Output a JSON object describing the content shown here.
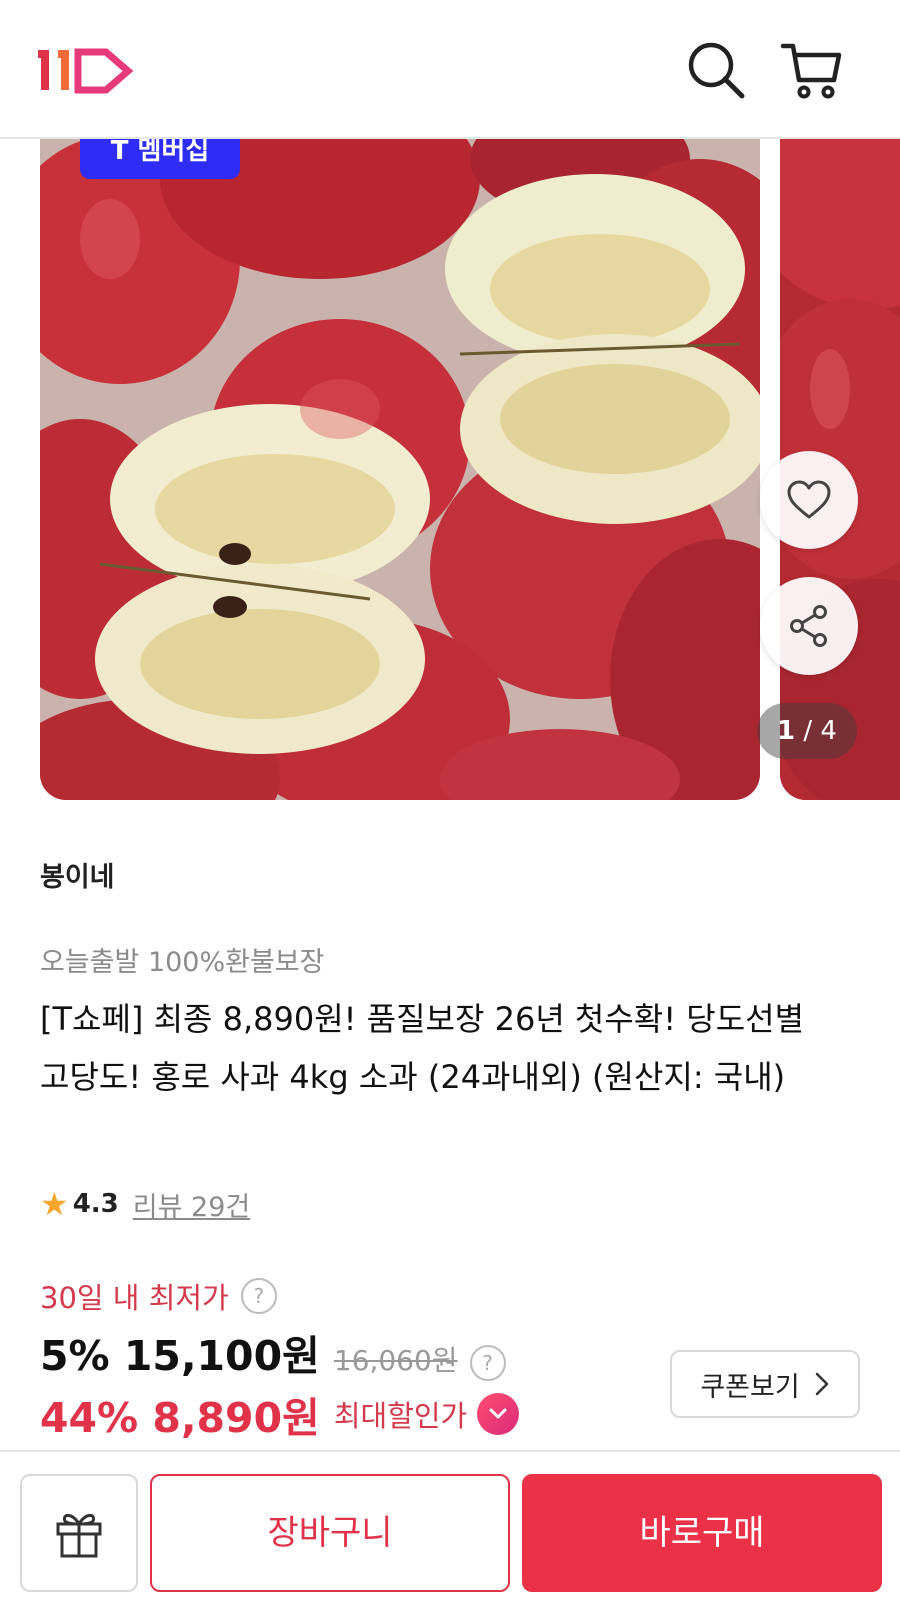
{
  "header": {
    "logo_alt": "11번가",
    "search_icon": "search-icon",
    "cart_icon": "cart-icon",
    "brand_color": "#e0334a"
  },
  "gallery": {
    "badge": "T 멤버십",
    "page_current": "1",
    "page_total": "4",
    "page_separator": " / ",
    "like_icon": "heart-outline-icon",
    "share_icon": "share-icon"
  },
  "product": {
    "seller": "봉이네",
    "tagline": "오늘출발 100%환불보장",
    "title": "[T쇼페] 최종 8,890원! 품질보장 26년 첫수확! 당도선별 고당도! 홍로 사과 4kg 소과 (24과내외) (원산지: 국내)",
    "rating": "4.3",
    "review_link": "리뷰 29건"
  },
  "pricing": {
    "lowest_label": "30일 내 최저가",
    "help_icon": "?",
    "discount1": "5% 15,100원",
    "original_price": "16,060원",
    "final_price": "44% 8,890원",
    "max_discount_label": "최대할인가",
    "coupon_button": "쿠폰보기"
  },
  "bottom_bar": {
    "gift_icon": "gift-icon",
    "cart_button": "장바구니",
    "buy_button": "바로구매",
    "accent_color": "#ea3147"
  }
}
